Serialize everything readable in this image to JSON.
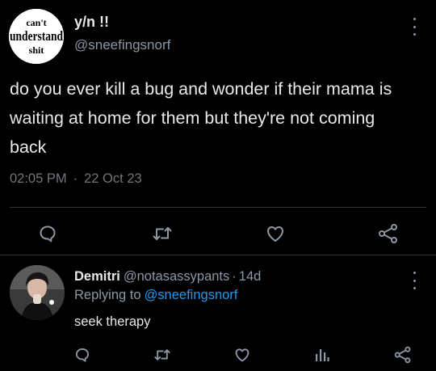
{
  "colors": {
    "background": "#000000",
    "text_primary": "#e7e9ea",
    "text_secondary": "#8b98a5",
    "link": "#1d9bf0",
    "divider": "#2f3336"
  },
  "tweet": {
    "author": {
      "display_name": "y/n !!",
      "handle": "@sneefingsnorf",
      "avatar": {
        "type": "text-logo",
        "words": [
          "can't",
          "understand",
          "shit"
        ]
      }
    },
    "text_lines": [
      "do you ever kill a bug and wonder if their mama is",
      "waiting at home for them but they're not coming",
      "back"
    ],
    "time": "02:05 PM",
    "separator": "·",
    "date": "22 Oct 23",
    "actions": [
      "reply-icon",
      "retweet-icon",
      "like-icon",
      "share-icon"
    ],
    "more_icon": "more-vertical-icon"
  },
  "reply": {
    "author": {
      "display_name": "Demitri",
      "handle": "@notasassypants",
      "avatar": {
        "type": "photo"
      }
    },
    "separator": "·",
    "time_ago": "14d",
    "replying_to_label": "Replying to",
    "replying_to_handle": "@sneefingsnorf",
    "text": "seek therapy",
    "actions": [
      "reply-icon",
      "retweet-icon",
      "like-icon",
      "views-icon",
      "share-icon"
    ],
    "more_icon": "more-vertical-icon"
  }
}
